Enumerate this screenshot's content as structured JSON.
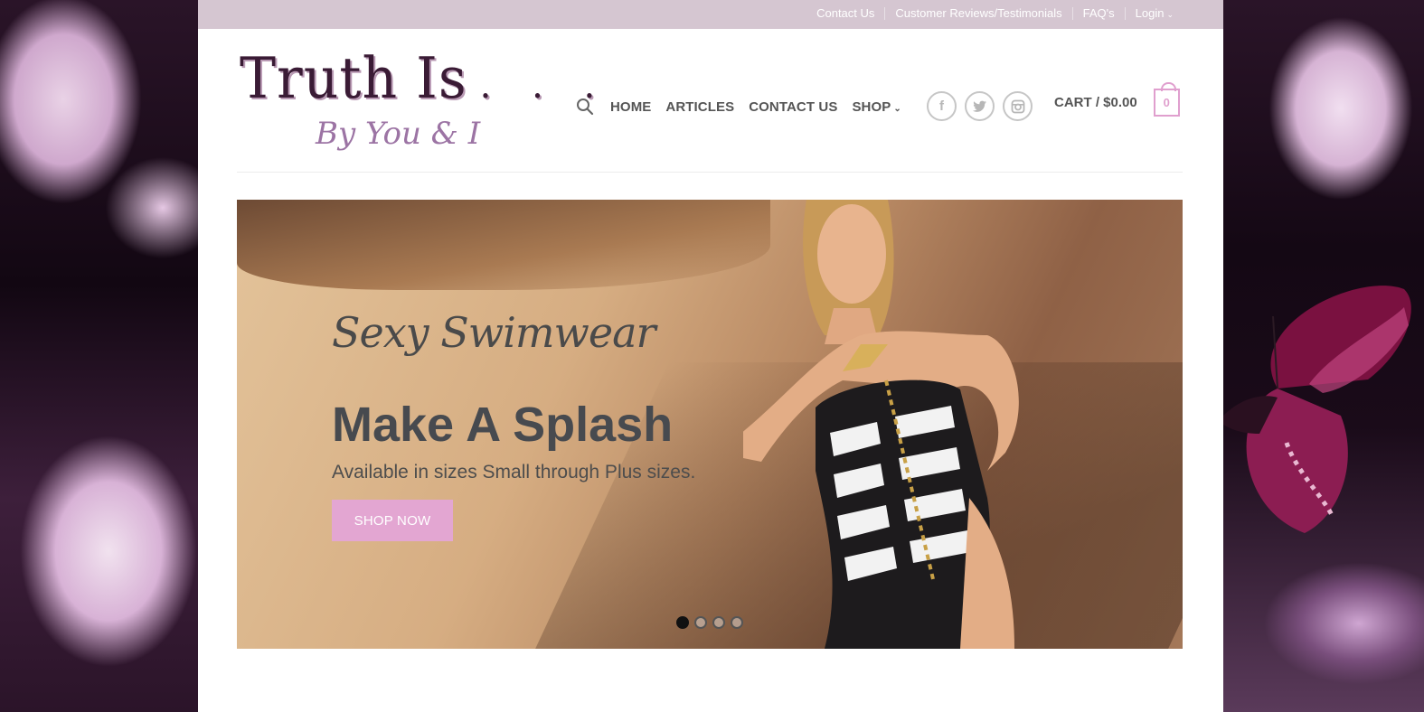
{
  "topbar": {
    "links": [
      "Contact Us",
      "Customer Reviews/Testimonials",
      "FAQ's",
      "Login"
    ]
  },
  "logo": {
    "title": "Truth Is",
    "dots": ". . .",
    "tagline": "By You & I"
  },
  "nav": {
    "items": [
      "HOME",
      "ARTICLES",
      "CONTACT US",
      "SHOP"
    ]
  },
  "socials": [
    "facebook-icon",
    "twitter-icon",
    "instagram-icon"
  ],
  "cart": {
    "label": "CART / $0.00",
    "count": "0"
  },
  "hero": {
    "script_heading": "Sexy Swimwear",
    "title": "Make A Splash",
    "subtitle": "Available in sizes Small through Plus sizes.",
    "button": "SHOP NOW",
    "slide_count": 4,
    "active_slide": 1
  },
  "colors": {
    "topbar": "#d5c6d1",
    "accent_pink": "#e3a6d2",
    "logo_dark": "#3a1b35",
    "logo_purple": "#9c74a4"
  }
}
